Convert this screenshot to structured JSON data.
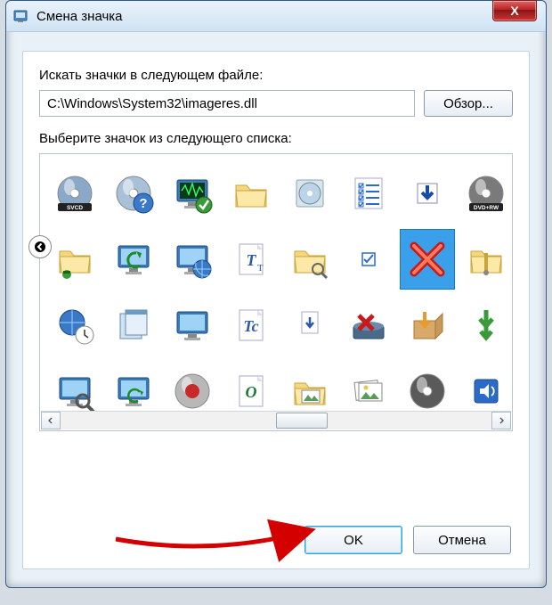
{
  "window": {
    "title": "Смена значка",
    "close_x": "X"
  },
  "labels": {
    "search_in": "Искать значки в следующем файле:",
    "select_from": "Выберите значок из следующего списка:"
  },
  "path": {
    "value": "C:\\Windows\\System32\\imageres.dll"
  },
  "buttons": {
    "browse": "Обзор...",
    "ok": "OK",
    "cancel": "Отмена"
  },
  "icons": [
    {
      "name": "svcd-disc",
      "selected": false
    },
    {
      "name": "help-disc",
      "selected": false
    },
    {
      "name": "monitor-check",
      "selected": false
    },
    {
      "name": "folder-plain",
      "selected": false
    },
    {
      "name": "disc-box",
      "selected": false
    },
    {
      "name": "checklist",
      "selected": false
    },
    {
      "name": "download-arrow",
      "selected": false
    },
    {
      "name": "dvd-rw-disc",
      "selected": false
    },
    {
      "name": "folder-share",
      "selected": false
    },
    {
      "name": "monitor-recycle",
      "selected": false
    },
    {
      "name": "monitor-globe",
      "selected": false
    },
    {
      "name": "truetype-file",
      "selected": false
    },
    {
      "name": "folder-open-search",
      "selected": false
    },
    {
      "name": "checkbox-small",
      "selected": false
    },
    {
      "name": "red-x",
      "selected": true
    },
    {
      "name": "folder-zip",
      "selected": false
    },
    {
      "name": "globe-clock",
      "selected": false
    },
    {
      "name": "window-stack",
      "selected": false
    },
    {
      "name": "monitor-side",
      "selected": false
    },
    {
      "name": "tc-file",
      "selected": false
    },
    {
      "name": "page-down",
      "selected": false
    },
    {
      "name": "drive-error",
      "selected": false
    },
    {
      "name": "box-arrow",
      "selected": false
    },
    {
      "name": "down-arrows",
      "selected": false
    },
    {
      "name": "monitor-search",
      "selected": false
    },
    {
      "name": "monitor-sync",
      "selected": false
    },
    {
      "name": "disc-red",
      "selected": false
    },
    {
      "name": "font-o-file",
      "selected": false
    },
    {
      "name": "folder-photo",
      "selected": false
    },
    {
      "name": "photo-stack",
      "selected": false
    },
    {
      "name": "disc-dark",
      "selected": false
    },
    {
      "name": "sound-icon",
      "selected": false
    }
  ]
}
